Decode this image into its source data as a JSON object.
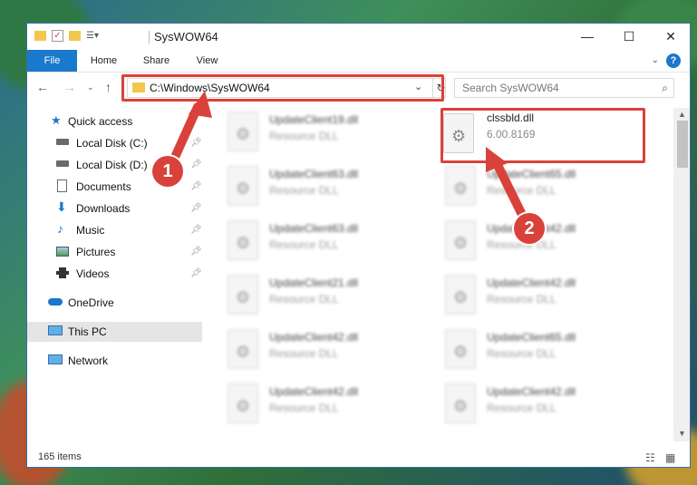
{
  "window": {
    "title": "SysWOW64",
    "controls": {
      "minimize": "—",
      "maximize": "☐",
      "close": "✕"
    }
  },
  "ribbon": {
    "tabs": [
      "File",
      "Home",
      "Share",
      "View"
    ],
    "help": "?"
  },
  "nav": {
    "address": "C:\\Windows\\SysWOW64",
    "search_placeholder": "Search SysWOW64"
  },
  "sidebar": {
    "items": [
      {
        "label": "Quick access",
        "icon": "star-icon",
        "pinned": false
      },
      {
        "label": "Local Disk (C:)",
        "icon": "drive-icon",
        "pinned": true
      },
      {
        "label": "Local Disk (D:)",
        "icon": "drive-icon",
        "pinned": true
      },
      {
        "label": "Documents",
        "icon": "documents-icon",
        "pinned": true
      },
      {
        "label": "Downloads",
        "icon": "downloads-icon",
        "pinned": true
      },
      {
        "label": "Music",
        "icon": "music-icon",
        "pinned": true
      },
      {
        "label": "Pictures",
        "icon": "pictures-icon",
        "pinned": true
      },
      {
        "label": "Videos",
        "icon": "videos-icon",
        "pinned": true
      },
      {
        "label": "OneDrive",
        "icon": "cloud-icon",
        "pinned": false
      },
      {
        "label": "This PC",
        "icon": "pc-icon",
        "pinned": false,
        "selected": true
      },
      {
        "label": "Network",
        "icon": "network-icon",
        "pinned": false
      }
    ]
  },
  "files": {
    "left": [
      {
        "name": "UpdateClient19.dll",
        "sub": "Resource DLL"
      },
      {
        "name": "UpdateClient63.dll",
        "sub": "Resource DLL"
      },
      {
        "name": "UpdateClient63.dll",
        "sub": "Resource DLL"
      },
      {
        "name": "UpdateClient21.dll",
        "sub": "Resource DLL"
      },
      {
        "name": "UpdateClient42.dll",
        "sub": "Resource DLL"
      },
      {
        "name": "UpdateClient42.dll",
        "sub": "Resource DLL"
      }
    ],
    "right": [
      {
        "name": "clssbld.dll",
        "sub": "6.00.8169"
      },
      {
        "name": "UpdateClient65.dll",
        "sub": "Resource DLL"
      },
      {
        "name": "UpdateClient42.dll",
        "sub": "Resource DLL"
      },
      {
        "name": "UpdateClient42.dll",
        "sub": "Resource DLL"
      },
      {
        "name": "UpdateClient65.dll",
        "sub": "Resource DLL"
      },
      {
        "name": "UpdateClient42.dll",
        "sub": "Resource DLL"
      }
    ]
  },
  "status": {
    "items": "165 items"
  },
  "annotations": {
    "marker1": "1",
    "marker2": "2"
  },
  "colors": {
    "accent": "#1979ca",
    "highlight": "#d9423a",
    "folder": "#f3c64e"
  }
}
